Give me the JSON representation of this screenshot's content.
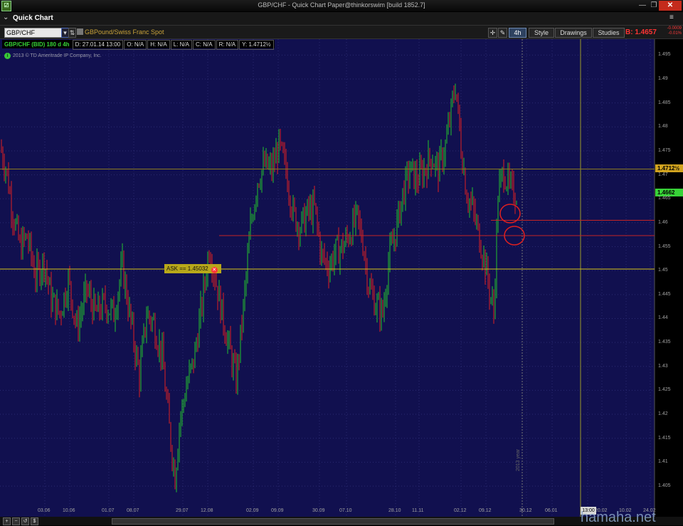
{
  "window": {
    "title": "GBP/CHF - Quick Chart Paper@thinkorswim [build 1852.7]",
    "icon": "thinkorswim-app-icon",
    "minimize": "—",
    "maximize": "❐",
    "close": "✕"
  },
  "panel": {
    "title": "Quick Chart",
    "menu_icon": "≡"
  },
  "toolbar": {
    "symbol_value": "GBP/CHF",
    "symbol_description": "GBPound/Swiss Franc Spot",
    "timeframe": "4h",
    "style_label": "Style",
    "drawings_label": "Drawings",
    "studies_label": "Studies",
    "bid_price": "B: 1.4657",
    "change_top": "-0.0009",
    "change_bottom": "-0.01%"
  },
  "status": {
    "symbol": "GBP/CHF (BID) 180 d 4h",
    "date": "D: 27.01.14 13:00",
    "open": "O: N/A",
    "high": "H: N/A",
    "low": "L: N/A",
    "close": "C: N/A",
    "range": "R: N/A",
    "y": "Y: 1.4712½"
  },
  "copyright": "2013 © TD Ameritrade IP Company, Inc.",
  "ask_label": "ASK == 1.45032",
  "price_badges": {
    "reference": "1.4712½",
    "last": "1.4662"
  },
  "year_label": "2013 year",
  "current_time": "13:00",
  "watermark": "hamaha.net",
  "colors": {
    "background": "#11104f",
    "up_candle": "#22c22c",
    "down_candle": "#e02020",
    "ask_line": "#d8c31a",
    "support_line": "#c42424"
  },
  "chart_data": {
    "type": "candlestick",
    "symbol": "GBP/CHF",
    "ylim": [
      1.4025,
      1.4975
    ],
    "y_ticks": [
      "1.405",
      "1.41",
      "1.415",
      "1.42",
      "1.425",
      "1.43",
      "1.435",
      "1.44",
      "1.445",
      "1.45",
      "1.455",
      "1.46",
      "1.465",
      "1.47",
      "1.475",
      "1.48",
      "1.485",
      "1.49",
      "1.495"
    ],
    "x_ticks": [
      "03.06",
      "10.06",
      "01.07",
      "08.07",
      "29.07",
      "12.08",
      "02.09",
      "09.09",
      "30.09",
      "07.10",
      "28.10",
      "11.11",
      "02.12",
      "09.12",
      "30.12",
      "06.01",
      "13.00",
      "20.02",
      "10.02",
      "24.02"
    ],
    "price_path": [
      [
        0,
        1.476
      ],
      [
        9,
        1.471
      ],
      [
        18,
        1.462
      ],
      [
        28,
        1.455
      ],
      [
        38,
        1.457
      ],
      [
        50,
        1.449
      ],
      [
        62,
        1.452
      ],
      [
        72,
        1.444
      ],
      [
        84,
        1.441
      ],
      [
        96,
        1.448
      ],
      [
        108,
        1.438
      ],
      [
        122,
        1.446
      ],
      [
        134,
        1.441
      ],
      [
        148,
        1.443
      ],
      [
        160,
        1.441
      ],
      [
        172,
        1.451
      ],
      [
        184,
        1.439
      ],
      [
        196,
        1.428
      ],
      [
        206,
        1.441
      ],
      [
        216,
        1.439
      ],
      [
        228,
        1.432
      ],
      [
        238,
        1.417
      ],
      [
        246,
        1.407
      ],
      [
        252,
        1.418
      ],
      [
        262,
        1.426
      ],
      [
        272,
        1.431
      ],
      [
        284,
        1.443
      ],
      [
        294,
        1.455
      ],
      [
        302,
        1.449
      ],
      [
        312,
        1.441
      ],
      [
        322,
        1.434
      ],
      [
        332,
        1.427
      ],
      [
        342,
        1.442
      ],
      [
        352,
        1.459
      ],
      [
        362,
        1.469
      ],
      [
        372,
        1.472
      ],
      [
        382,
        1.471
      ],
      [
        392,
        1.476
      ],
      [
        402,
        1.471
      ],
      [
        412,
        1.462
      ],
      [
        422,
        1.459
      ],
      [
        432,
        1.462
      ],
      [
        442,
        1.463
      ],
      [
        452,
        1.453
      ],
      [
        462,
        1.451
      ],
      [
        472,
        1.454
      ],
      [
        482,
        1.455
      ],
      [
        492,
        1.458
      ],
      [
        502,
        1.461
      ],
      [
        510,
        1.456
      ],
      [
        518,
        1.447
      ],
      [
        528,
        1.443
      ],
      [
        538,
        1.441
      ],
      [
        546,
        1.452
      ],
      [
        556,
        1.458
      ],
      [
        566,
        1.466
      ],
      [
        576,
        1.471
      ],
      [
        586,
        1.469
      ],
      [
        596,
        1.471
      ],
      [
        606,
        1.474
      ],
      [
        616,
        1.471
      ],
      [
        626,
        1.476
      ],
      [
        634,
        1.483
      ],
      [
        640,
        1.489
      ],
      [
        648,
        1.476
      ],
      [
        656,
        1.466
      ],
      [
        664,
        1.463
      ],
      [
        672,
        1.458
      ],
      [
        680,
        1.453
      ],
      [
        688,
        1.446
      ],
      [
        694,
        1.441
      ],
      [
        700,
        1.466
      ],
      [
        708,
        1.471
      ],
      [
        716,
        1.467
      ],
      [
        724,
        1.4662
      ]
    ],
    "horizontal_lines": [
      {
        "label": "ASK == 1.45032",
        "value": 1.45032
      },
      {
        "value": 1.4712
      },
      {
        "value": 1.4605
      },
      {
        "value": 1.4573
      }
    ],
    "annotations": [
      "circle near 1.461",
      "circle near 1.457"
    ]
  }
}
